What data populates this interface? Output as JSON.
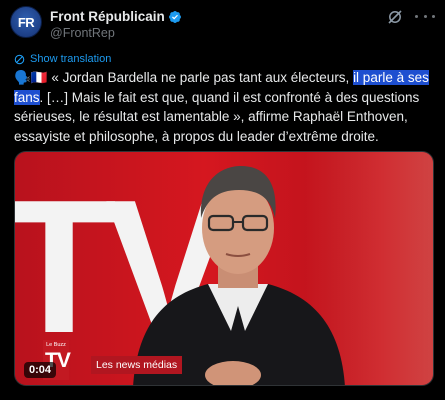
{
  "author": {
    "display_name": "Front Républicain",
    "handle": "@FrontRep",
    "avatar_initials": "FR",
    "verified": true
  },
  "translate": {
    "label": "Show translation"
  },
  "tweet": {
    "emoji_prefix": "🗣️🇫🇷",
    "text_before_highlight": " « Jordan Bardella ne parle pas tant aux électeurs, ",
    "text_highlight": "il parle à ses fans",
    "text_after_highlight": ". […] Mais le fait est que, quand il est confronté à des questions sérieuses, le résultat est lamentable », affirme Raphaël Enthoven, essayiste et philosophe, à propos du leader d’extrême droite."
  },
  "media": {
    "background_text": "TV",
    "logo_small": "Le Buzz",
    "logo_tv": "TV",
    "lower_third": "Les news médias",
    "timestamp": "0:04"
  },
  "colors": {
    "accent": "#1d9bf0",
    "highlight": "#1e4fd0",
    "background": "#000000",
    "muted": "#71767b"
  },
  "icons": [
    "verified-badge-icon",
    "grok-icon",
    "more-icon",
    "translate-icon"
  ]
}
